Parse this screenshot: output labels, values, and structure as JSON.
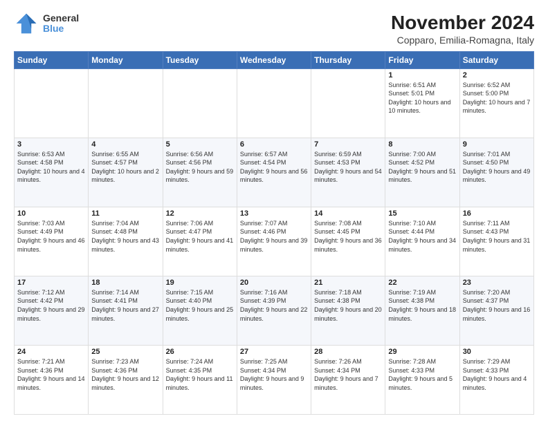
{
  "logo": {
    "general": "General",
    "blue": "Blue"
  },
  "header": {
    "title": "November 2024",
    "subtitle": "Copparo, Emilia-Romagna, Italy"
  },
  "days_of_week": [
    "Sunday",
    "Monday",
    "Tuesday",
    "Wednesday",
    "Thursday",
    "Friday",
    "Saturday"
  ],
  "weeks": [
    {
      "days": [
        {
          "num": "",
          "info": ""
        },
        {
          "num": "",
          "info": ""
        },
        {
          "num": "",
          "info": ""
        },
        {
          "num": "",
          "info": ""
        },
        {
          "num": "",
          "info": ""
        },
        {
          "num": "1",
          "info": "Sunrise: 6:51 AM\nSunset: 5:01 PM\nDaylight: 10 hours and 10 minutes."
        },
        {
          "num": "2",
          "info": "Sunrise: 6:52 AM\nSunset: 5:00 PM\nDaylight: 10 hours and 7 minutes."
        }
      ]
    },
    {
      "days": [
        {
          "num": "3",
          "info": "Sunrise: 6:53 AM\nSunset: 4:58 PM\nDaylight: 10 hours and 4 minutes."
        },
        {
          "num": "4",
          "info": "Sunrise: 6:55 AM\nSunset: 4:57 PM\nDaylight: 10 hours and 2 minutes."
        },
        {
          "num": "5",
          "info": "Sunrise: 6:56 AM\nSunset: 4:56 PM\nDaylight: 9 hours and 59 minutes."
        },
        {
          "num": "6",
          "info": "Sunrise: 6:57 AM\nSunset: 4:54 PM\nDaylight: 9 hours and 56 minutes."
        },
        {
          "num": "7",
          "info": "Sunrise: 6:59 AM\nSunset: 4:53 PM\nDaylight: 9 hours and 54 minutes."
        },
        {
          "num": "8",
          "info": "Sunrise: 7:00 AM\nSunset: 4:52 PM\nDaylight: 9 hours and 51 minutes."
        },
        {
          "num": "9",
          "info": "Sunrise: 7:01 AM\nSunset: 4:50 PM\nDaylight: 9 hours and 49 minutes."
        }
      ]
    },
    {
      "days": [
        {
          "num": "10",
          "info": "Sunrise: 7:03 AM\nSunset: 4:49 PM\nDaylight: 9 hours and 46 minutes."
        },
        {
          "num": "11",
          "info": "Sunrise: 7:04 AM\nSunset: 4:48 PM\nDaylight: 9 hours and 43 minutes."
        },
        {
          "num": "12",
          "info": "Sunrise: 7:06 AM\nSunset: 4:47 PM\nDaylight: 9 hours and 41 minutes."
        },
        {
          "num": "13",
          "info": "Sunrise: 7:07 AM\nSunset: 4:46 PM\nDaylight: 9 hours and 39 minutes."
        },
        {
          "num": "14",
          "info": "Sunrise: 7:08 AM\nSunset: 4:45 PM\nDaylight: 9 hours and 36 minutes."
        },
        {
          "num": "15",
          "info": "Sunrise: 7:10 AM\nSunset: 4:44 PM\nDaylight: 9 hours and 34 minutes."
        },
        {
          "num": "16",
          "info": "Sunrise: 7:11 AM\nSunset: 4:43 PM\nDaylight: 9 hours and 31 minutes."
        }
      ]
    },
    {
      "days": [
        {
          "num": "17",
          "info": "Sunrise: 7:12 AM\nSunset: 4:42 PM\nDaylight: 9 hours and 29 minutes."
        },
        {
          "num": "18",
          "info": "Sunrise: 7:14 AM\nSunset: 4:41 PM\nDaylight: 9 hours and 27 minutes."
        },
        {
          "num": "19",
          "info": "Sunrise: 7:15 AM\nSunset: 4:40 PM\nDaylight: 9 hours and 25 minutes."
        },
        {
          "num": "20",
          "info": "Sunrise: 7:16 AM\nSunset: 4:39 PM\nDaylight: 9 hours and 22 minutes."
        },
        {
          "num": "21",
          "info": "Sunrise: 7:18 AM\nSunset: 4:38 PM\nDaylight: 9 hours and 20 minutes."
        },
        {
          "num": "22",
          "info": "Sunrise: 7:19 AM\nSunset: 4:38 PM\nDaylight: 9 hours and 18 minutes."
        },
        {
          "num": "23",
          "info": "Sunrise: 7:20 AM\nSunset: 4:37 PM\nDaylight: 9 hours and 16 minutes."
        }
      ]
    },
    {
      "days": [
        {
          "num": "24",
          "info": "Sunrise: 7:21 AM\nSunset: 4:36 PM\nDaylight: 9 hours and 14 minutes."
        },
        {
          "num": "25",
          "info": "Sunrise: 7:23 AM\nSunset: 4:36 PM\nDaylight: 9 hours and 12 minutes."
        },
        {
          "num": "26",
          "info": "Sunrise: 7:24 AM\nSunset: 4:35 PM\nDaylight: 9 hours and 11 minutes."
        },
        {
          "num": "27",
          "info": "Sunrise: 7:25 AM\nSunset: 4:34 PM\nDaylight: 9 hours and 9 minutes."
        },
        {
          "num": "28",
          "info": "Sunrise: 7:26 AM\nSunset: 4:34 PM\nDaylight: 9 hours and 7 minutes."
        },
        {
          "num": "29",
          "info": "Sunrise: 7:28 AM\nSunset: 4:33 PM\nDaylight: 9 hours and 5 minutes."
        },
        {
          "num": "30",
          "info": "Sunrise: 7:29 AM\nSunset: 4:33 PM\nDaylight: 9 hours and 4 minutes."
        }
      ]
    }
  ]
}
